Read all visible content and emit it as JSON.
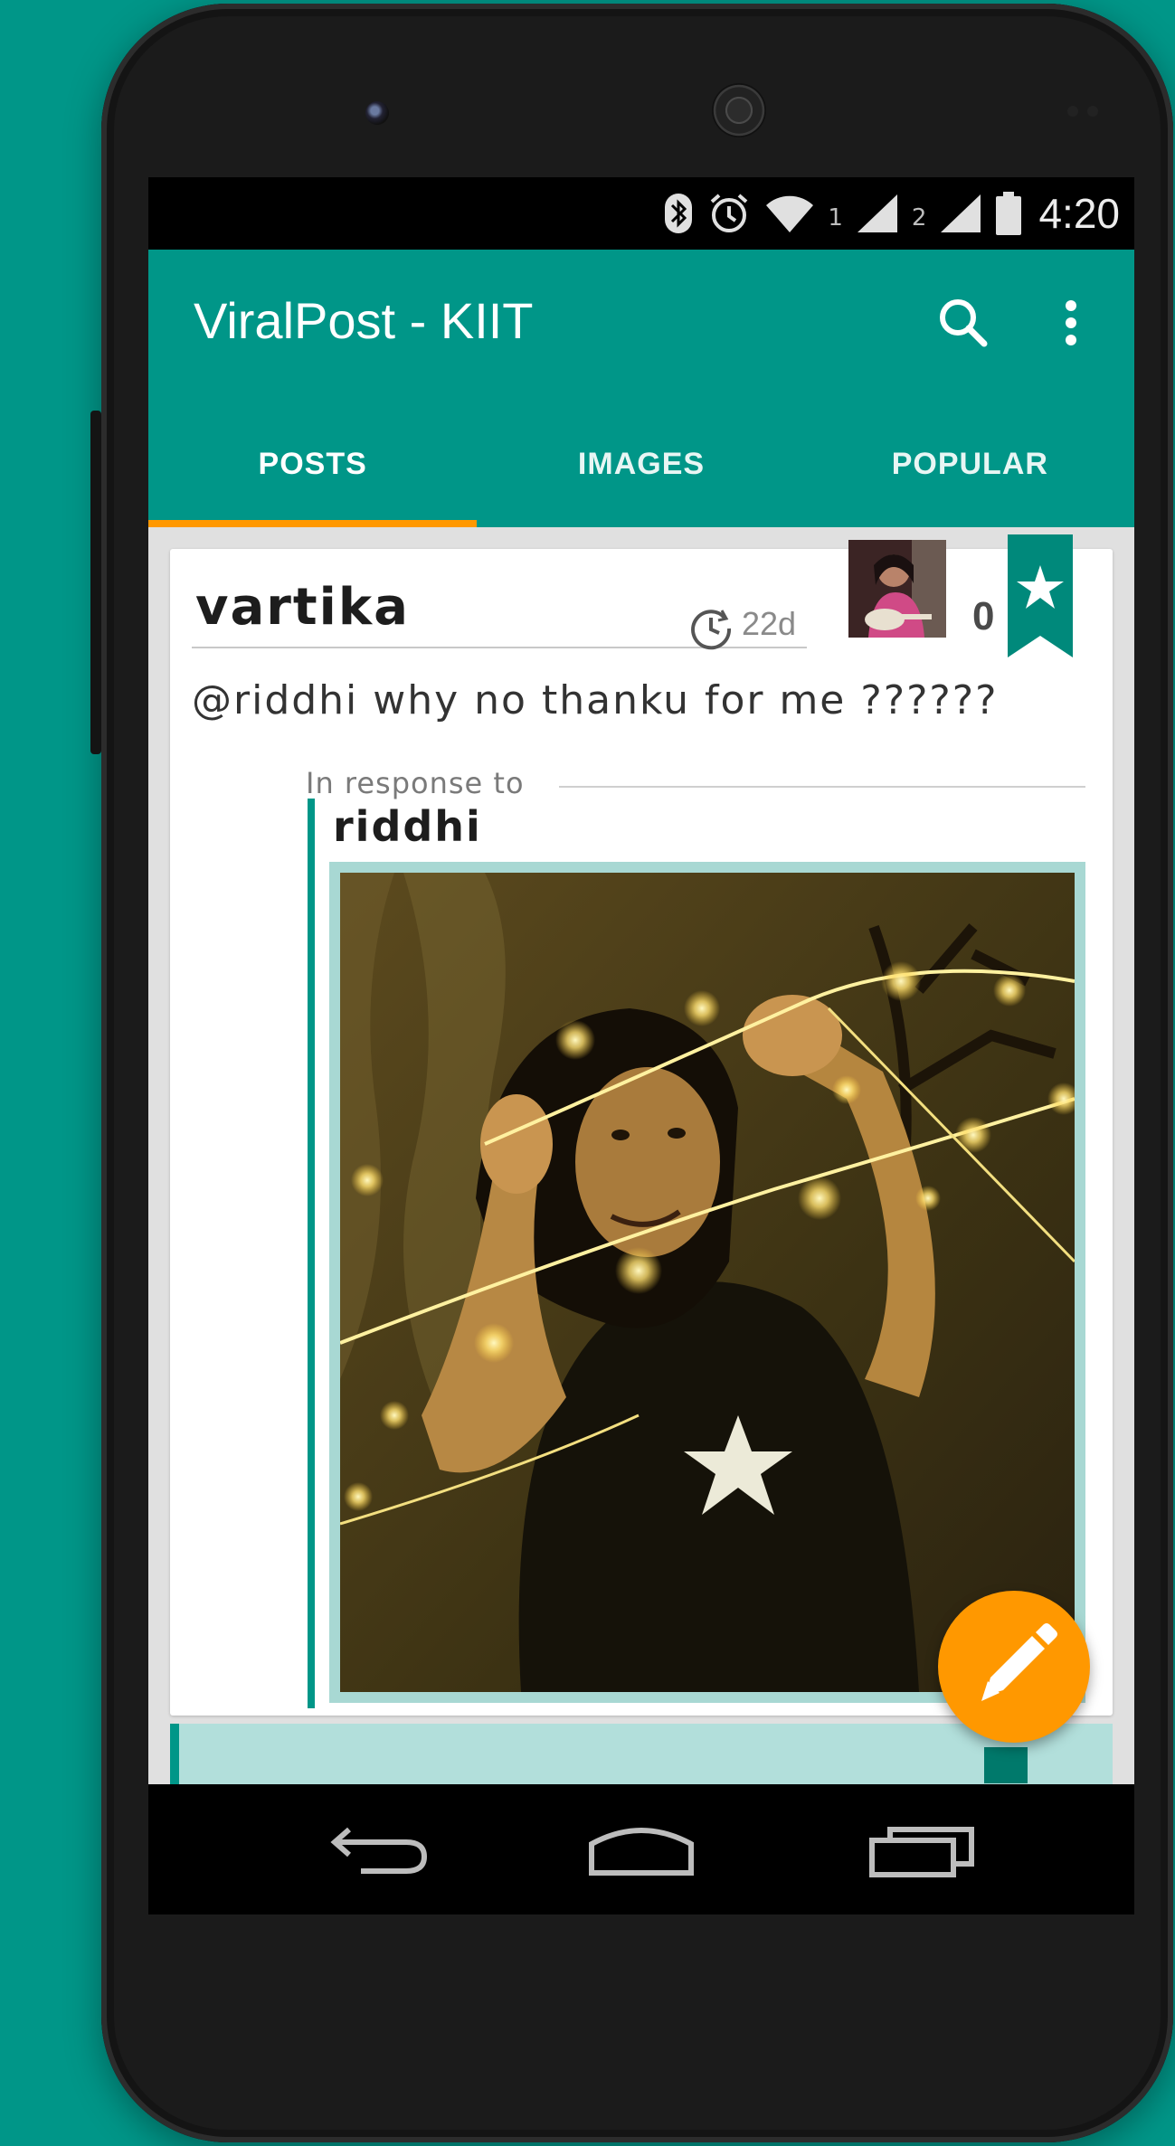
{
  "status_bar": {
    "sim1": "1",
    "sim2": "2",
    "time": "4:20",
    "icons": [
      "bluetooth-icon",
      "alarm-icon",
      "wifi-icon",
      "signal-icon",
      "battery-icon"
    ]
  },
  "app_bar": {
    "title": "ViralPost - KIIT",
    "actions": [
      "search-icon",
      "more-vert-icon"
    ]
  },
  "tabs": [
    {
      "label": "POSTS",
      "selected": true
    },
    {
      "label": "IMAGES",
      "selected": false
    },
    {
      "label": "POPULAR",
      "selected": false
    }
  ],
  "post": {
    "author": "vartika",
    "age": "22d",
    "likes": "0",
    "text": "@riddhi why no thanku for me ??????",
    "in_response_to_label": "In response to",
    "quoted_author": "riddhi"
  },
  "colors": {
    "primary": "#009688",
    "accent": "#ff9800",
    "quote_frame": "#a8d8d3"
  },
  "fab": {
    "icon": "pencil-icon"
  }
}
